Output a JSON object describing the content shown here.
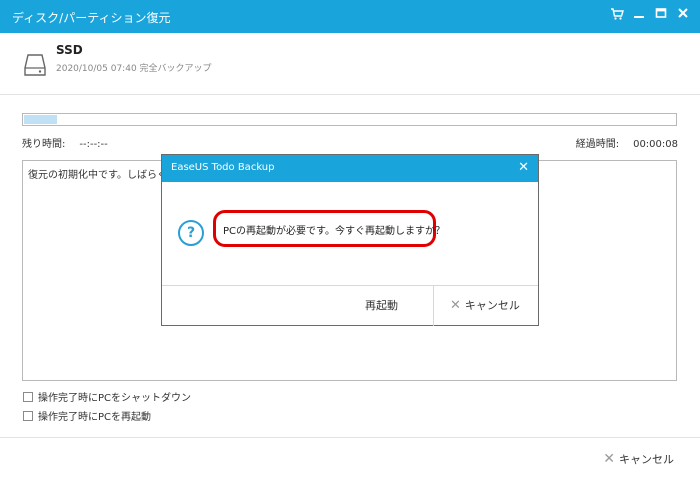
{
  "window": {
    "title": "ディスク/パーティション復元"
  },
  "header": {
    "drive_name": "SSD",
    "backup_info": "2020/10/05 07:40 完全バックアップ"
  },
  "progress": {
    "fraction": 0.05
  },
  "status": {
    "remaining_label": "残り時間:",
    "remaining_value": "--:--:--",
    "elapsed_label": "経過時間:",
    "elapsed_value": "00:00:08"
  },
  "log": {
    "line": "復元の初期化中です。しばらくお"
  },
  "options": {
    "shutdown_label": "操作完了時にPCをシャットダウン",
    "restart_label": "操作完了時にPCを再起動"
  },
  "footer": {
    "cancel_label": "キャンセル"
  },
  "dialog": {
    "title": "EaseUS Todo Backup",
    "message": "PCの再起動が必要です。今すぐ再起動しますか？",
    "restart_label": "再起動",
    "cancel_label": "キャンセル"
  },
  "colors": {
    "accent": "#1aa4dc",
    "highlight": "#e00000"
  }
}
